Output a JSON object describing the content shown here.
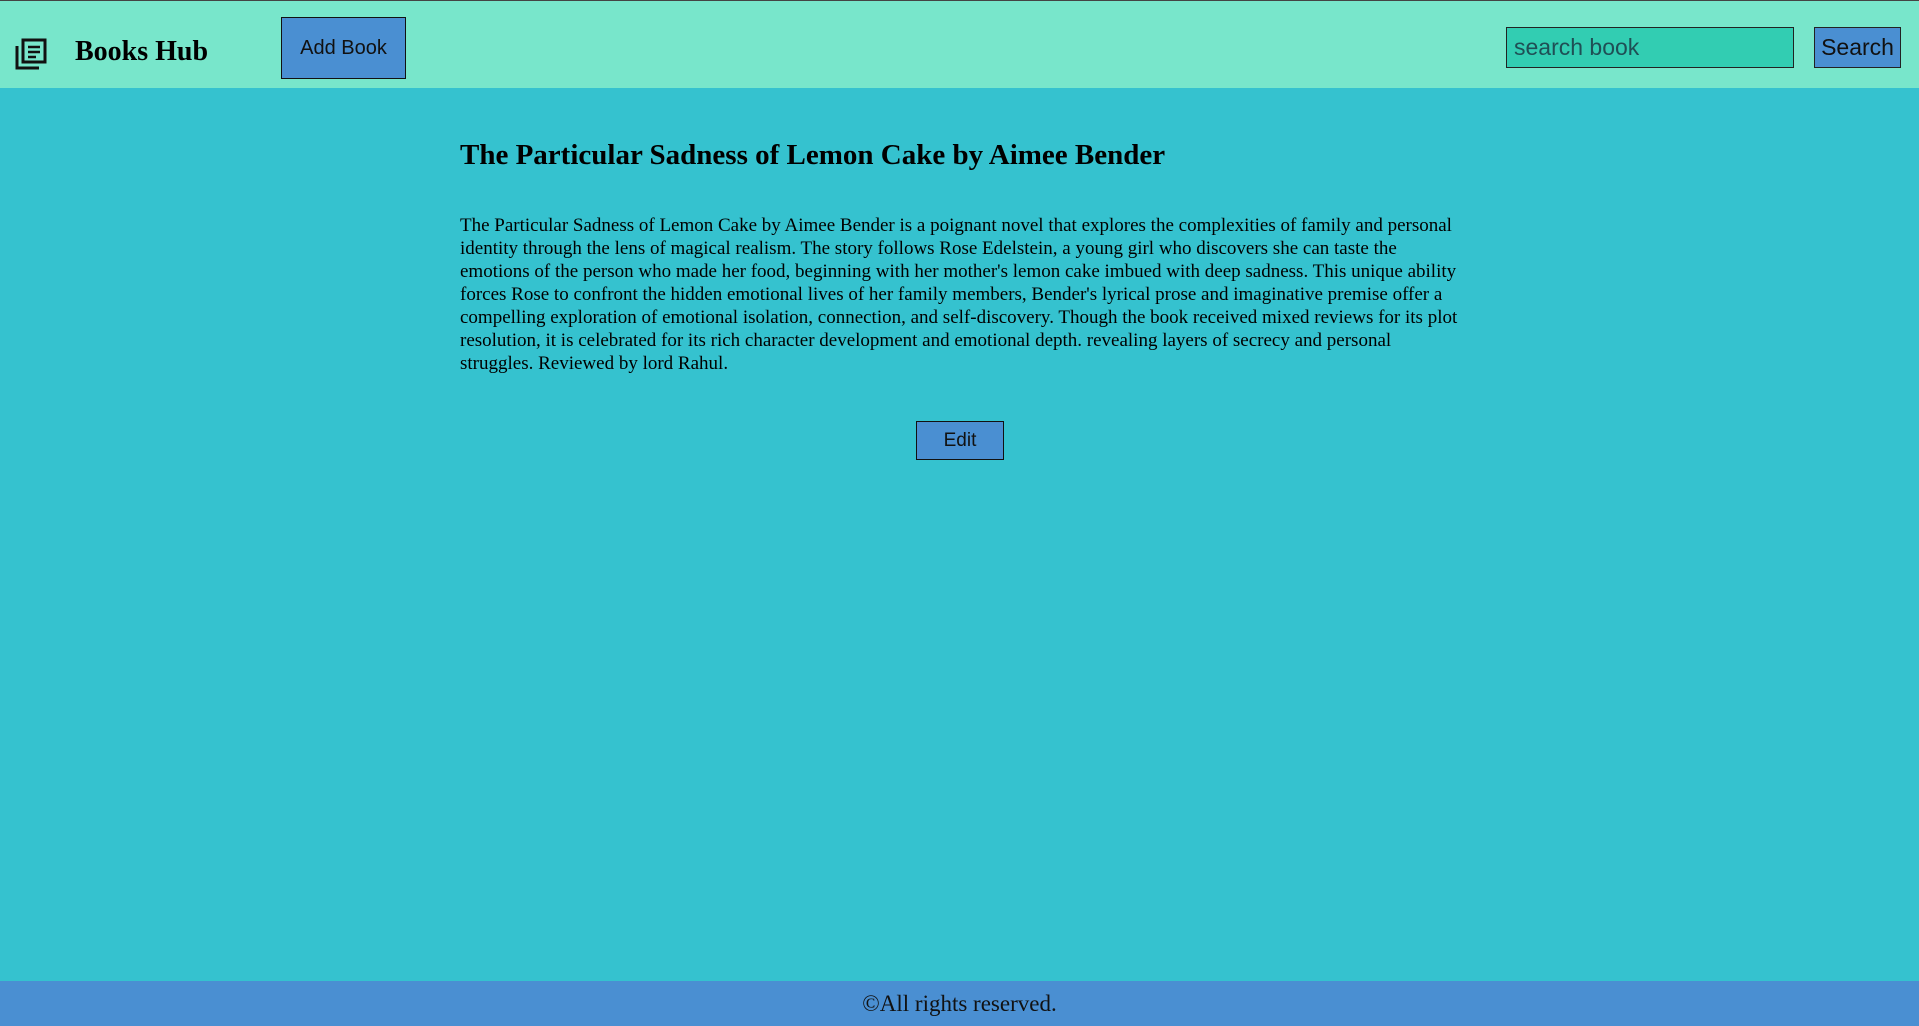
{
  "header": {
    "logo_icon": "newspaper-list-icon",
    "brand": "Books Hub",
    "add_book_label": "Add Book",
    "search": {
      "placeholder": "search book",
      "value": "",
      "button_label": "Search"
    }
  },
  "book": {
    "title": "The Particular Sadness of Lemon Cake by Aimee Bender",
    "description": "The Particular Sadness of Lemon Cake by Aimee Bender is a poignant novel that explores the complexities of family and personal identity through the lens of magical realism. The story follows Rose Edelstein, a young girl who discovers she can taste the emotions of the person who made her food, beginning with her mother's lemon cake imbued with deep sadness. This unique ability forces Rose to confront the hidden emotional lives of her family members, Bender's lyrical prose and imaginative premise offer a compelling exploration of emotional isolation, connection, and self-discovery. Though the book received mixed reviews for its plot resolution, it is celebrated for its rich character development and emotional depth. revealing layers of secrecy and personal struggles. Reviewed by lord Rahul.",
    "edit_label": "Edit"
  },
  "footer": {
    "text": "©All rights reserved."
  },
  "colors": {
    "page_background": "#35c2cf",
    "header_background": "#78e6cb",
    "button_background": "#4a8fd2",
    "search_background": "#32cdb2",
    "footer_background": "#4a8fd2"
  }
}
